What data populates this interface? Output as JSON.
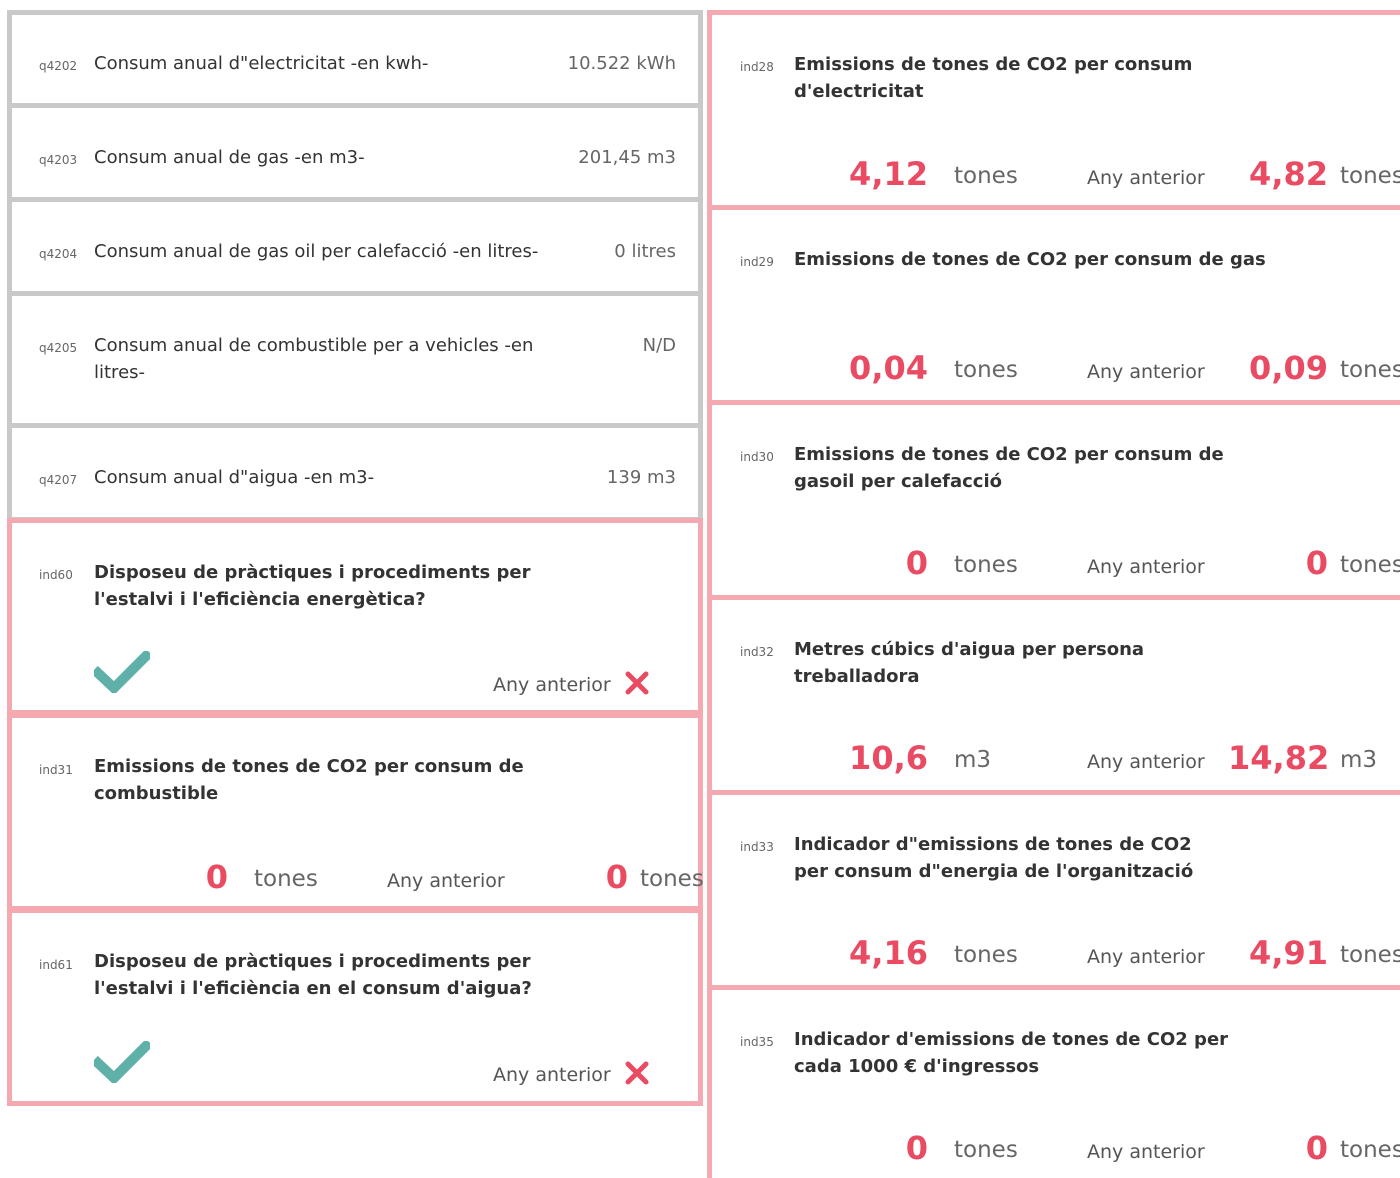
{
  "questions": [
    {
      "code": "q4202",
      "label": "Consum anual d\"electricitat -en kwh-",
      "value": "10.522 kWh"
    },
    {
      "code": "q4203",
      "label": "Consum anual de gas -en m3-",
      "value": "201,45 m3"
    },
    {
      "code": "q4204",
      "label": "Consum anual de gas oil per calefacció -en litres-",
      "value": "0 litres"
    },
    {
      "code": "q4205",
      "label": "Consum anual de combustible per a vehicles -en litres-",
      "value": "N/D"
    },
    {
      "code": "q4207",
      "label": "Consum anual d\"aigua -en m3-",
      "value": "139 m3"
    }
  ],
  "previous_label": "Any anterior",
  "left_indicators": [
    {
      "code": "ind60",
      "label": "Disposeu de pràctiques i procediments per l'estalvi i l'eficiència energètica?",
      "current": "check-icon",
      "previous": "cross-icon"
    },
    {
      "code": "ind31",
      "label": "Emissions de tones de CO2 per consum de combustible",
      "value": "0",
      "unit": "tones",
      "prev_value": "0",
      "prev_unit": "tones"
    },
    {
      "code": "ind61",
      "label": "Disposeu de pràctiques i procediments per l'estalvi i l'eficiència en el consum d'aigua?",
      "current": "check-icon",
      "previous": "cross-icon"
    }
  ],
  "right_indicators": [
    {
      "code": "ind28",
      "label": "Emissions de tones de CO2 per consum d'electricitat",
      "value": "4,12",
      "unit": "tones",
      "prev_value": "4,82",
      "prev_unit": "tones"
    },
    {
      "code": "ind29",
      "label": "Emissions de tones de CO2 per consum de gas",
      "value": "0,04",
      "unit": "tones",
      "prev_value": "0,09",
      "prev_unit": "tones"
    },
    {
      "code": "ind30",
      "label": "Emissions de tones de CO2 per consum de gasoil per calefacció",
      "value": "0",
      "unit": "tones",
      "prev_value": "0",
      "prev_unit": "tones"
    },
    {
      "code": "ind32",
      "label": "Metres cúbics d'aigua per persona treballadora",
      "value": "10,6",
      "unit": "m3",
      "prev_value": "14,82",
      "prev_unit": "m3"
    },
    {
      "code": "ind33",
      "label": "Indicador d\"emissions de tones de CO2 per consum d\"energia de l'organització",
      "value": "4,16",
      "unit": "tones",
      "prev_value": "4,91",
      "prev_unit": "tones"
    },
    {
      "code": "ind35",
      "label": "Indicador d'emissions de tones de CO2 per cada 1000 € d'ingressos",
      "value": "0",
      "unit": "tones",
      "prev_value": "0",
      "prev_unit": "tones"
    }
  ],
  "colors": {
    "accent": "#e94b63",
    "check": "#5fb0a8",
    "cross": "#e94b63",
    "border_grey": "#c9c9c9",
    "border_pink": "#f4a9b0"
  }
}
